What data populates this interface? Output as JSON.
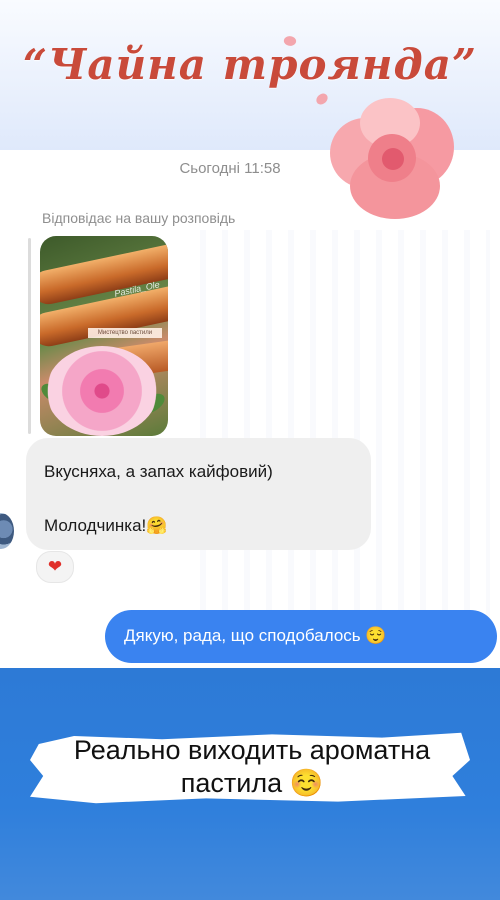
{
  "header": {
    "title": "“Чайна троянда”"
  },
  "chat": {
    "timestamp": "Сьогодні 11:58",
    "reply_label": "Відповідає на вашу розповідь",
    "story_thumbnail": {
      "brand_text": "Pastila_Ole",
      "label_text": "Мистецтво пастили"
    },
    "incoming_message": {
      "line1": "Вкусняха, а запах кайфовий)",
      "line2": "Молодчинка!🤗"
    },
    "reaction": "❤",
    "outgoing_message": "Дякую, рада, що сподобалось 😌"
  },
  "footer": {
    "caption": "Реально виходить ароматна пастила ☺️"
  },
  "colors": {
    "title": "#c94a3a",
    "outgoing_bubble": "#3a83f0",
    "incoming_bubble": "#efefef",
    "bottom_band": "#2f7fdc"
  },
  "icons": [
    "peony-flower-icon",
    "heart-reaction-icon",
    "avatar-icon"
  ]
}
